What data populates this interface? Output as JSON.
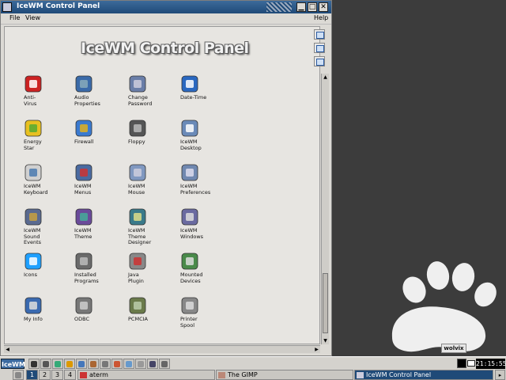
{
  "window": {
    "title": "IceWM Control Panel",
    "buttons": {
      "minimize": "▁",
      "maximize": "□",
      "close": "✕"
    }
  },
  "menubar": {
    "file": "File",
    "view": "View",
    "help": "Help"
  },
  "header": {
    "title": "IceWM Control Panel"
  },
  "items": [
    {
      "label": "Anti-\nVirus",
      "icon": "antivirus-icon"
    },
    {
      "label": "Audio\nProperties",
      "icon": "audio-icon"
    },
    {
      "label": "Change\nPassword",
      "icon": "password-icon"
    },
    {
      "label": "Date-Time",
      "icon": "clock-icon"
    },
    {
      "label": "Energy\nStar",
      "icon": "energy-icon"
    },
    {
      "label": "Firewall",
      "icon": "firewall-icon"
    },
    {
      "label": "Floppy",
      "icon": "floppy-icon"
    },
    {
      "label": "IceWM\nDesktop",
      "icon": "desktop-icon"
    },
    {
      "label": "IceWM\nKeyboard",
      "icon": "keyboard-icon"
    },
    {
      "label": "IceWM\nMenus",
      "icon": "menus-icon"
    },
    {
      "label": "IceWM\nMouse",
      "icon": "mouse-icon"
    },
    {
      "label": "IceWM\nPreferences",
      "icon": "preferences-icon"
    },
    {
      "label": "IceWM\nSound\nEvents",
      "icon": "sound-events-icon"
    },
    {
      "label": "IceWM\nTheme",
      "icon": "theme-icon"
    },
    {
      "label": "IceWM\nTheme\nDesigner",
      "icon": "theme-designer-icon"
    },
    {
      "label": "IceWM\nWindows",
      "icon": "windows-icon"
    },
    {
      "label": "Icons",
      "icon": "icons-icon"
    },
    {
      "label": "Installed\nPrograms",
      "icon": "programs-icon"
    },
    {
      "label": "Java\nPlugin",
      "icon": "java-icon"
    },
    {
      "label": "Mounted\nDevices",
      "icon": "mounted-icon"
    },
    {
      "label": "My Info",
      "icon": "myinfo-icon"
    },
    {
      "label": "ODBC",
      "icon": "odbc-icon"
    },
    {
      "label": "PCMCIA",
      "icon": "pcmcia-icon"
    },
    {
      "label": "Printer\nSpool",
      "icon": "printer-icon"
    }
  ],
  "taskbar": {
    "start": "IceWM",
    "workspaces": [
      "1",
      "2",
      "3",
      "4"
    ],
    "tasks": [
      {
        "label": "aterm",
        "active": false
      },
      {
        "label": "The GIMP",
        "active": false
      },
      {
        "label": "IceWM Control Panel",
        "active": true
      }
    ],
    "clock": "21:15:55"
  },
  "desktop": {
    "brand": "wolvix"
  },
  "colors": {
    "titlebar": "#1f4a78",
    "desktop": "#3c3c3c",
    "window_bg": "#dcdad5"
  }
}
